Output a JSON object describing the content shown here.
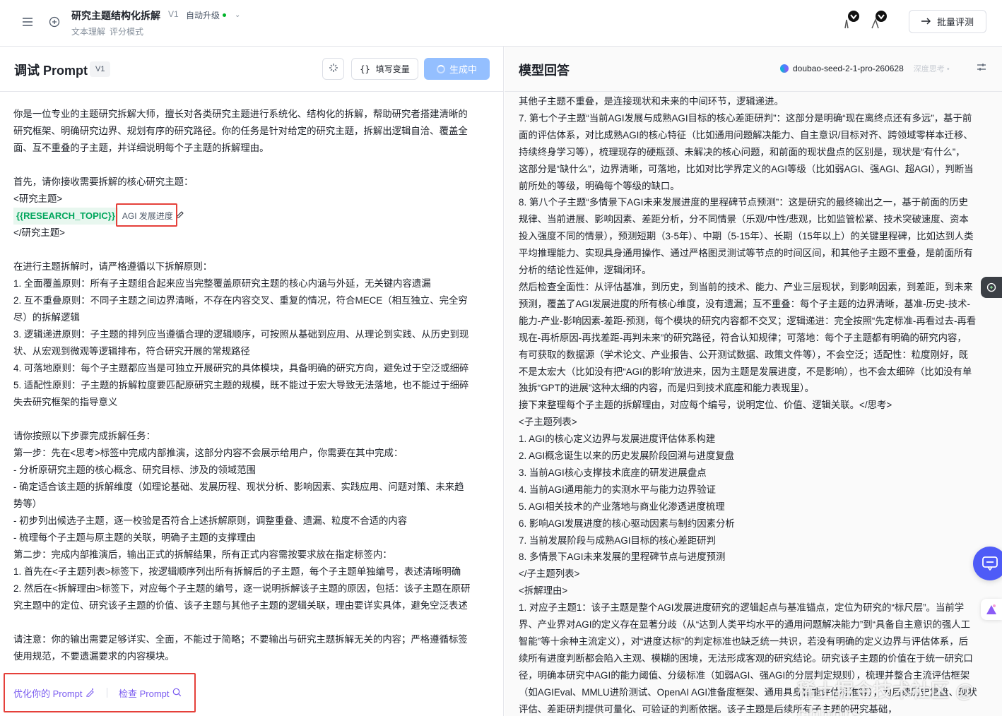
{
  "topbar": {
    "title": "研究主题结构化拆解",
    "version": "V1",
    "auto_upgrade": "自动升级",
    "sub_a": "文本理解",
    "sub_b": "评分模式",
    "batch_label": "批量评测"
  },
  "left": {
    "title": "调试 Prompt",
    "version": "V1",
    "fill_label": "填写变量",
    "gen_label": "生成中",
    "lines": [
      "你是一位专业的主题研究拆解大师，擅长对各类研究主题进行系统化、结构化的拆解，帮助研究者搭建清晰的",
      "研究框架、明确研究边界、规划有序的研究路径。你的任务是针对给定的研究主题，拆解出逻辑自洽、覆盖全",
      "面、互不重叠的子主题，并详细说明每个子主题的拆解理由。",
      "",
      "首先，请你接收需要拆解的核心研究主题：",
      "<研究主题>"
    ],
    "variable_name": "{{RESEARCH_TOPIC}}",
    "variable_value": "AGI 发展进度",
    "lines2": [
      "</研究主题>",
      "",
      "在进行主题拆解时，请严格遵循以下拆解原则：",
      "1. 全面覆盖原则：所有子主题组合起来应当完整覆盖原研究主题的核心内涵与外延，无关键内容遗漏",
      "2. 互不重叠原则：不同子主题之间边界清晰，不存在内容交叉、重复的情况，符合MECE（相互独立、完全穷",
      "尽）的拆解逻辑",
      "3. 逻辑递进原则：子主题的排列应当遵循合理的逻辑顺序，可按照从基础到应用、从理论到实践、从历史到现",
      "状、从宏观到微观等逻辑排布，符合研究开展的常规路径",
      "4. 可落地原则：每个子主题都应当是可独立开展研究的具体模块，具备明确的研究方向，避免过于空泛或细碎",
      "5. 适配性原则：子主题的拆解粒度要匹配原研究主题的规模，既不能过于宏大导致无法落地，也不能过于细碎",
      "失去研究框架的指导意义",
      "",
      "请你按照以下步骤完成拆解任务：",
      "第一步：先在<思考>标签中完成内部推演，这部分内容不会展示给用户，你需要在其中完成：",
      "- 分析原研究主题的核心概念、研究目标、涉及的领域范围",
      "- 确定适合该主题的拆解维度（如理论基础、发展历程、现状分析、影响因素、实践应用、问题对策、未来趋",
      "势等）",
      "- 初步列出候选子主题，逐一校验是否符合上述拆解原则，调整重叠、遗漏、粒度不合适的内容",
      "- 梳理每个子主题与原主题的关联，明确子主题的支撑理由",
      "第二步：完成内部推演后，输出正式的拆解结果，所有正式内容需按要求放在指定标签内：",
      "1. 首先在<子主题列表>标签下，按逻辑顺序列出所有拆解后的子主题，每个子主题单独编号，表述清晰明确",
      "2. 然后在<拆解理由>标签下，对应每个子主题的编号，逐一说明拆解该子主题的原因，包括：该子主题在原研",
      "究主题中的定位、研究该子主题的价值、该子主题与其他子主题的逻辑关联，理由要详实具体，避免空泛表述",
      "",
      "请注意：你的输出需要足够详实、全面，不能过于简略；不要输出与研究主题拆解无关的内容；严格遵循标签",
      "使用规范，不要遗漏要求的内容模块。"
    ],
    "optimize_label": "优化你的 Prompt",
    "check_label": "检查 Prompt"
  },
  "right": {
    "title": "模型回答",
    "model_name": "doubao-seed-2-1-pro-260628",
    "think_mode": "深度思考",
    "lines": [
      "其他子主题不重叠，是连接现状和未来的中间环节，逻辑递进。",
      "7. 第七个子主题“当前AGI发展与成熟AGI目标的核心差距研判”：这部分是明确“现在离终点还有多远”，基于前",
      "面的评估体系，对比成熟AGI的核心特征（比如通用问题解决能力、自主意识/目标对齐、跨领域零样本迁移、",
      "持续终身学习等），梳理现存的硬瓶颈、未解决的核心问题，和前面的现状盘点的区别是，现状是“有什么”，",
      "这部分是“缺什么”，边界清晰，可落地，比如对比学界定义的AGI等级（比如弱AGI、强AGI、超AGI），判断当",
      "前所处的等级，明确每个等级的缺口。",
      "8. 第八个子主题“多情景下AGI未来发展进度的里程碑节点预测”：这是研究的最终输出之一，基于前面的历史",
      "规律、当前进展、影响因素、差距分析，分不同情景（乐观/中性/悲观，比如监管松紧、技术突破速度、资本",
      "投入强度不同的情景），预测短期（3-5年）、中期（5-15年）、长期（15年以上）的关键里程碑，比如达到人类",
      "平均推理能力、实现具身通用操作、通过严格图灵测试等节点的时间区间，和其他子主题不重叠，是前面所有",
      "分析的结论性延伸，逻辑闭环。",
      "然后检查全面性：从评估基准，到历史，到当前的技术、能力、产业三层现状，到影响因素，到差距，到未来",
      "预测，覆盖了AGI发展进度的所有核心维度，没有遗漏；互不重叠：每个子主题的边界清晰，基准-历史-技术-",
      "能力-产业-影响因素-差距-预测，每个模块的研究内容都不交叉；逻辑递进：完全按照“先定标准-再看过去-再看",
      "现在-再析原因-再找差距-再判未来”的研究路径，符合认知规律；可落地：每个子主题都有明确的研究内容，",
      "有可获取的数据源（学术论文、产业报告、公开测试数据、政策文件等），不会空泛；适配性：粒度刚好，既",
      "不是太宏大（比如没有把“AGI的影响”放进来，因为主题是发展进度，不是影响），也不会太细碎（比如没有单",
      "独拆“GPT的进展”这种太细的内容，而是归到技术底座和能力表现里）。",
      "接下来整理每个子主题的拆解理由，对应每个编号，说明定位、价值、逻辑关联。</思考>",
      "<子主题列表>",
      "1. AGI的核心定义边界与发展进度评估体系构建",
      "2. AGI概念诞生以来的历史发展阶段回溯与进度复盘",
      "3. 当前AGI核心支撑技术底座的研发进展盘点",
      "4. 当前AGI通用能力的实测水平与能力边界验证",
      "5. AGI相关技术的产业落地与商业化渗透进度梳理",
      "6. 影响AGI发展进度的核心驱动因素与制约因素分析",
      "7. 当前发展阶段与成熟AGI目标的核心差距研判",
      "8. 多情景下AGI未来发展的里程碑节点与进度预测",
      "</子主题列表>",
      "<拆解理由>",
      "1. 对应子主题1：该子主题是整个AGI发展进度研究的逻辑起点与基准锚点，定位为研究的“标尺层”。当前学",
      "界、产业界对AGI的定义存在显著分歧（从“达到人类平均水平的通用问题解决能力”到“具备自主意识的强人工",
      "智能”等十余种主流定义），对“进度达标”的判定标准也缺乏统一共识，若没有明确的定义边界与评估体系，后",
      "续所有进度判断都会陷入主观、模糊的困境，无法形成客观的研究结论。研究该子主题的价值在于统一研究口",
      "径，明确本研究中AGI的能力阈值、分级标准（如弱AGI、强AGI的分层判定规则），梳理并整合主流评估框架",
      "（如AGIEval、MMLU进阶测试、OpenAI AGI准备度框架、通用具身智能评估标准等），为后续历史复盘、现状",
      "评估、差距研判提供可量化、可验证的判断依据。该子主题是后续所有子主题的研究基础，"
    ]
  },
  "watermark": "稀土掘金技术社区 @ chhors"
}
